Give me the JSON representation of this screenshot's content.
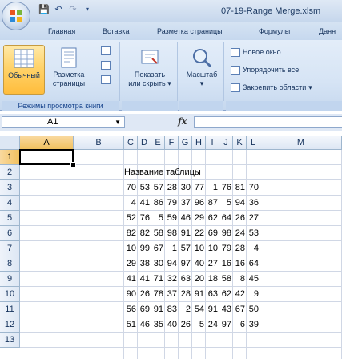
{
  "window": {
    "title": "07-19-Range Merge.xlsm"
  },
  "quick_access": {
    "icons": [
      "save-icon",
      "undo-icon",
      "redo-icon",
      "customize-icon"
    ]
  },
  "tabs": [
    "Главная",
    "Вставка",
    "Разметка страницы",
    "Формулы",
    "Данн"
  ],
  "ribbon": {
    "views_group": {
      "label": "Режимы просмотра книги",
      "normal": "Обычный",
      "page_layout_line1": "Разметка",
      "page_layout_line2": "страницы"
    },
    "show_hide": {
      "line1": "Показать",
      "line2": "или скрыть"
    },
    "zoom": {
      "label": "Масштаб"
    },
    "window_group": {
      "new_window": "Новое окно",
      "arrange_all": "Упорядочить все",
      "freeze_panes": "Закрепить области"
    }
  },
  "formula_bar": {
    "name_box": "A1",
    "fx": "fx",
    "formula": ""
  },
  "grid": {
    "columns": [
      "A",
      "B",
      "C",
      "D",
      "E",
      "F",
      "G",
      "H",
      "I",
      "J",
      "K",
      "L",
      "M"
    ],
    "rows": [
      "1",
      "2",
      "3",
      "4",
      "5",
      "6",
      "7",
      "8",
      "9",
      "10",
      "11",
      "12",
      "13"
    ],
    "active_cell": "A1",
    "merged_title": "Название таблицы",
    "data": [
      [
        "70",
        "53",
        "57",
        "28",
        "30",
        "77",
        "1",
        "76",
        "81",
        "70"
      ],
      [
        "4",
        "41",
        "86",
        "79",
        "37",
        "96",
        "87",
        "5",
        "94",
        "36"
      ],
      [
        "52",
        "76",
        "5",
        "59",
        "46",
        "29",
        "62",
        "64",
        "26",
        "27"
      ],
      [
        "82",
        "82",
        "58",
        "98",
        "91",
        "22",
        "69",
        "98",
        "24",
        "53"
      ],
      [
        "10",
        "99",
        "67",
        "1",
        "57",
        "10",
        "10",
        "79",
        "28",
        "4"
      ],
      [
        "29",
        "38",
        "30",
        "94",
        "97",
        "40",
        "27",
        "16",
        "16",
        "64"
      ],
      [
        "41",
        "41",
        "71",
        "32",
        "63",
        "20",
        "18",
        "58",
        "8",
        "45"
      ],
      [
        "90",
        "26",
        "78",
        "37",
        "28",
        "91",
        "63",
        "62",
        "42",
        "9"
      ],
      [
        "56",
        "69",
        "91",
        "83",
        "2",
        "54",
        "91",
        "43",
        "67",
        "50"
      ],
      [
        "51",
        "46",
        "35",
        "40",
        "26",
        "5",
        "24",
        "97",
        "6",
        "39"
      ]
    ]
  }
}
